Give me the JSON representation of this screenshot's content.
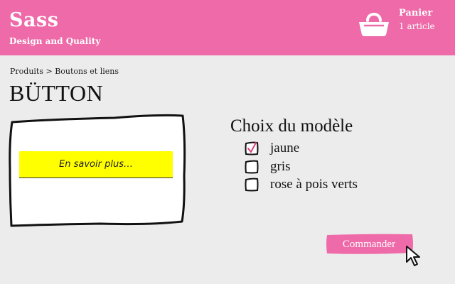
{
  "header": {
    "brand": "Sass",
    "tagline": "Design and Quality",
    "cart_label": "Panier",
    "cart_count": "1 article",
    "basket_icon": "basket-icon"
  },
  "breadcrumb": "Produits > Boutons et liens",
  "page_title": "BÜTTON",
  "preview": {
    "button_label": "En savoir plus…",
    "button_color": "#ffff00"
  },
  "options": {
    "title": "Choix du modèle",
    "items": [
      {
        "label": "jaune",
        "checked": true
      },
      {
        "label": "gris",
        "checked": false
      },
      {
        "label": "rose à pois verts",
        "checked": false
      }
    ]
  },
  "order_button": {
    "label": "Commander",
    "color": "#ee6aa8"
  },
  "colors": {
    "accent": "#ee6aa8",
    "background": "#ececec",
    "check_mark": "#e0407f"
  }
}
